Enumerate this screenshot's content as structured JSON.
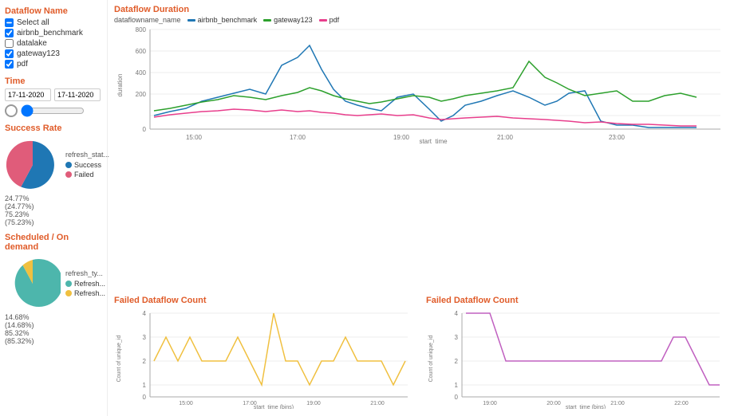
{
  "sidebar": {
    "dataflow_title": "Dataflow Name",
    "select_label": "Select",
    "checkboxes": [
      {
        "label": "Select all",
        "checked": false,
        "indeterminate": true
      },
      {
        "label": "airbnb_benchmark",
        "checked": true
      },
      {
        "label": "datalake",
        "checked": false
      },
      {
        "label": "gateway123",
        "checked": true
      },
      {
        "label": "pdf",
        "checked": true
      }
    ],
    "time_title": "Time",
    "date_from": "17-11-2020",
    "date_to": "17-11-2020",
    "success_title": "Success Rate",
    "success_data": {
      "success_pct": "75.23%",
      "success_val": "(75.23%)",
      "failed_pct": "24.77%",
      "failed_val": "(24.77%)"
    },
    "scheduled_title": "Scheduled / On demand",
    "scheduled_data": {
      "refresh1_pct": "85.32%",
      "refresh1_val": "(85.32%)",
      "refresh2_pct": "14.68%",
      "refresh2_val": "(14.68%)"
    }
  },
  "main": {
    "duration_title": "Dataflow Duration",
    "duration_legend_label": "dataflowname_name",
    "duration_series": [
      "airbnb_benchmark",
      "gateway123",
      "pdf"
    ],
    "duration_colors": [
      "#1f77b4",
      "#2ca02c",
      "#e83e8c"
    ],
    "failed_count_title": "Failed Dataflow Count",
    "failed_count_xlabel": "start_time (bins)",
    "failed_count2_title": "Failed Dataflow Count",
    "failed_count2_xlabel": "start_time (bins)",
    "duration_xlabel": "start_time",
    "duration_ylabel": "duration",
    "failed_ylabel": "Count of unique_id"
  }
}
